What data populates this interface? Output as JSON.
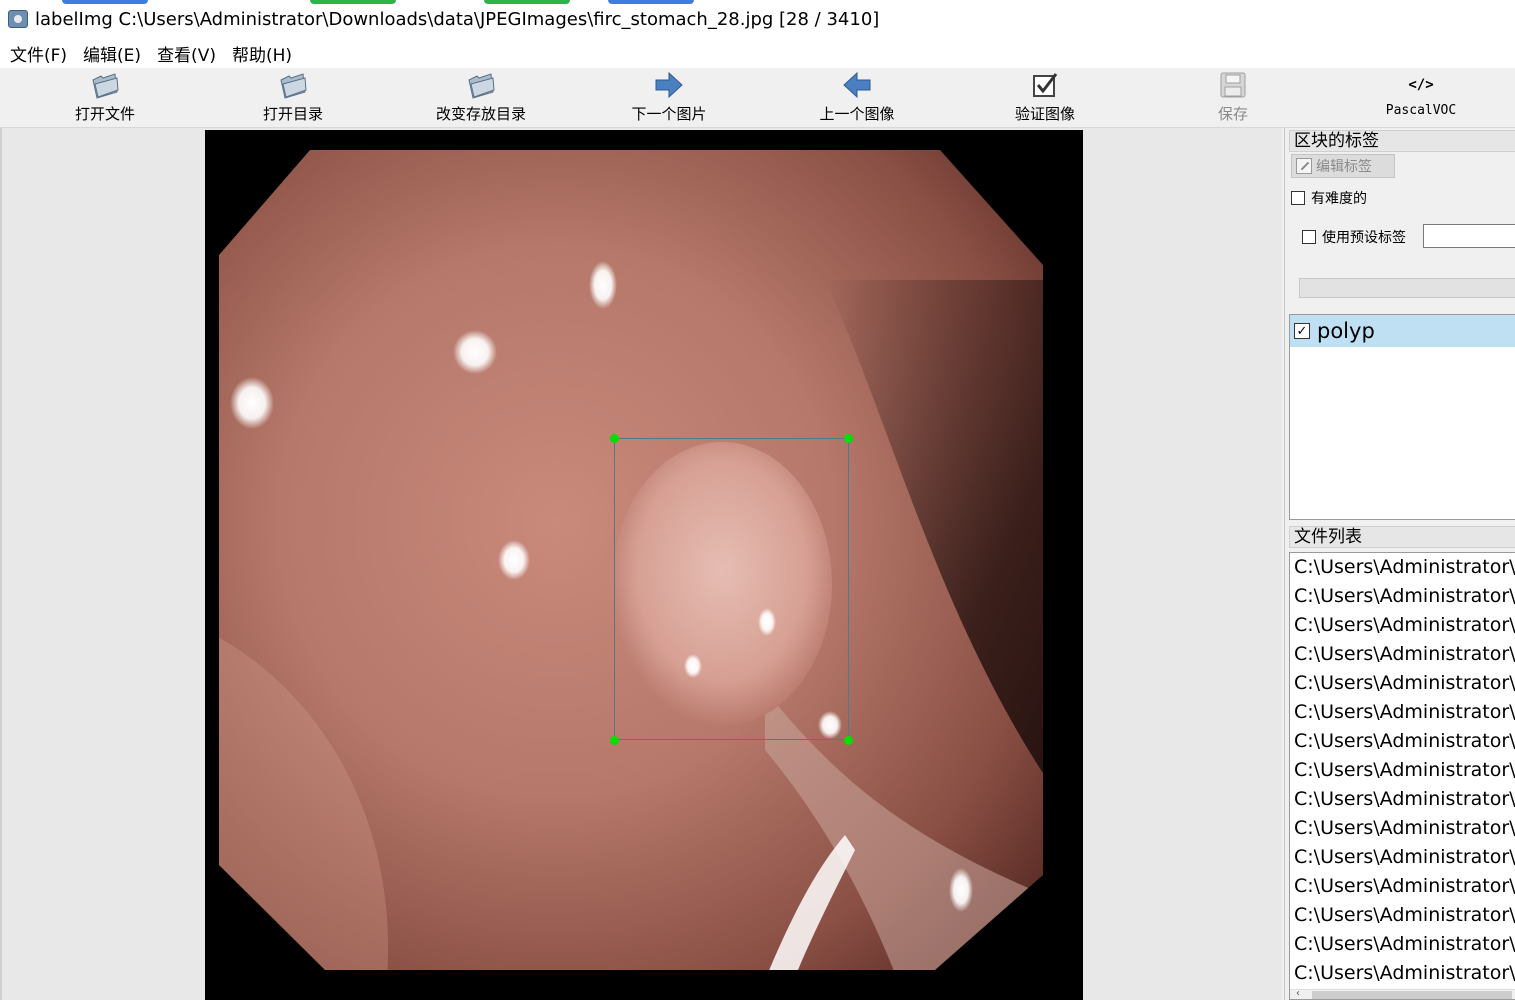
{
  "window": {
    "title": "labelImg C:\\Users\\Administrator\\Downloads\\data\\JPEGImages\\firc_stomach_28.jpg [28 / 3410]"
  },
  "menu": [
    "文件(F)",
    "编辑(E)",
    "查看(V)",
    "帮助(H)"
  ],
  "toolbar": {
    "open_file": "打开文件",
    "open_dir": "打开目录",
    "change_save_dir": "改变存放目录",
    "next_image": "下一个图片",
    "prev_image": "上一个图像",
    "verify_image": "验证图像",
    "save": "保存",
    "format": "PascalVOC",
    "format_icon_text": "</>"
  },
  "dock": {
    "box_labels_title": "区块的标签",
    "edit_label": "编辑标签",
    "difficult": "有难度的",
    "use_default_label": "使用预设标签",
    "labels": [
      {
        "name": "polyp",
        "checked": true
      }
    ],
    "file_list_title": "文件列表",
    "files": [
      "C:\\Users\\Administrator\\",
      "C:\\Users\\Administrator\\",
      "C:\\Users\\Administrator\\",
      "C:\\Users\\Administrator\\",
      "C:\\Users\\Administrator\\",
      "C:\\Users\\Administrator\\",
      "C:\\Users\\Administrator\\",
      "C:\\Users\\Administrator\\",
      "C:\\Users\\Administrator\\",
      "C:\\Users\\Administrator\\",
      "C:\\Users\\Administrator\\",
      "C:\\Users\\Administrator\\",
      "C:\\Users\\Administrator\\",
      "C:\\Users\\Administrator\\",
      "C:\\Users\\Administrator\\"
    ]
  },
  "colors": {
    "bbox_stroke": "#4f7a8a",
    "bbox_handle": "#00e000",
    "selected_label_bg": "#bfe0f2"
  }
}
